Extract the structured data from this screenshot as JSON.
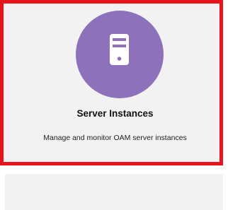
{
  "tile": {
    "title": "Server Instances",
    "description": "Manage and monitor OAM server instances",
    "icon": "server-icon",
    "colors": {
      "icon_background": "#8d72bb",
      "highlight_border": "#e8131b",
      "tile_background": "#f2f2f2"
    }
  }
}
